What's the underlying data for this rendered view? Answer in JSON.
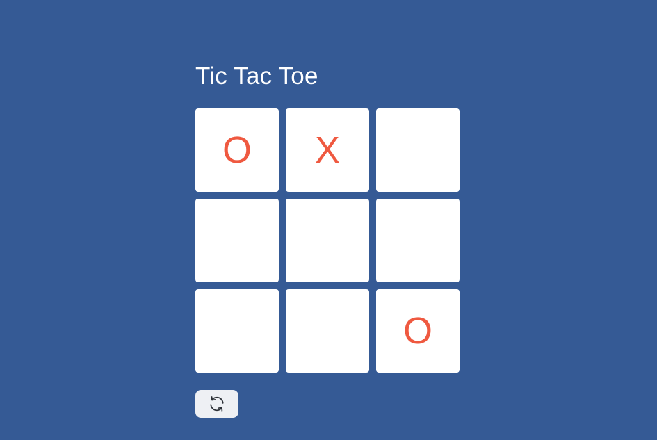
{
  "title": "Tic Tac Toe",
  "board": {
    "cells": [
      "O",
      "X",
      "",
      "",
      "",
      "",
      "",
      "",
      "O"
    ]
  },
  "controls": {
    "reset_icon": "refresh-icon"
  },
  "colors": {
    "background": "#355a95",
    "mark": "#ef5940",
    "cell": "#ffffff"
  }
}
